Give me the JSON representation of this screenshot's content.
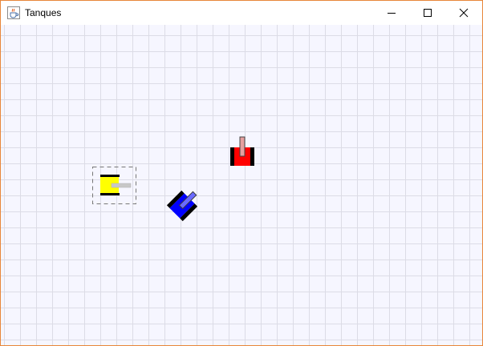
{
  "window": {
    "title": "Tanques",
    "icon": "java-cup-icon"
  },
  "controls": {
    "minimize_icon": "minimize-icon",
    "maximize_icon": "maximize-icon",
    "close_icon": "close-icon"
  },
  "colors": {
    "window_border": "#e8863a",
    "grid_line": "#dcdce6",
    "background": "#f6f6ff",
    "tank_yellow": "#ffff00",
    "tank_red": "#ff0000",
    "tank_blue": "#0000ff",
    "tread": "#000000",
    "cannon": "#c8c8c8"
  },
  "tanks": [
    {
      "name": "yellow-tank",
      "color": "yellow",
      "facing": "right",
      "selected": true
    },
    {
      "name": "red-tank",
      "color": "red",
      "facing": "up",
      "selected": false
    },
    {
      "name": "blue-tank",
      "color": "blue",
      "facing": "up-right",
      "selected": false
    }
  ]
}
